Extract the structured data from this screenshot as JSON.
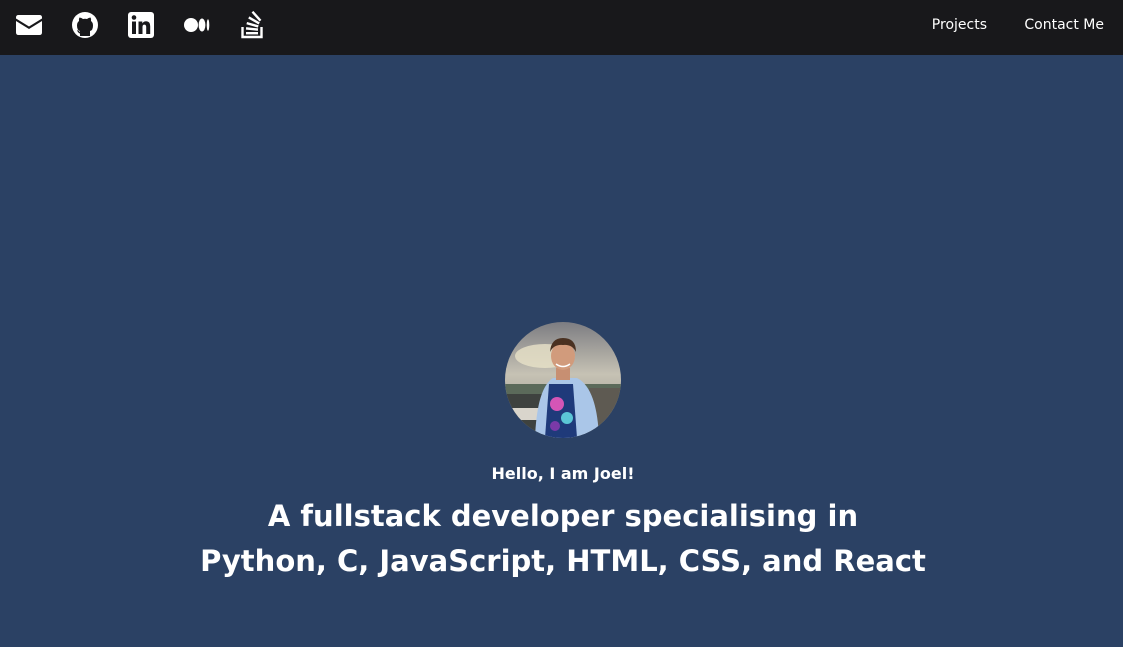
{
  "navbar": {
    "social_icons": [
      "envelope-icon",
      "github-icon",
      "linkedin-icon",
      "medium-icon",
      "stack-overflow-icon"
    ],
    "links": [
      "Projects",
      "Contact Me"
    ]
  },
  "hero": {
    "avatar": "profile-photo",
    "greeting": "Hello, I am Joel!",
    "headline_line1": "A fullstack developer specialising in",
    "headline_line2": "Python, C, JavaScript, HTML, CSS, and React"
  },
  "colors": {
    "navbar_bg": "#18181b",
    "hero_bg": "#2b4164",
    "text": "#ffffff"
  }
}
